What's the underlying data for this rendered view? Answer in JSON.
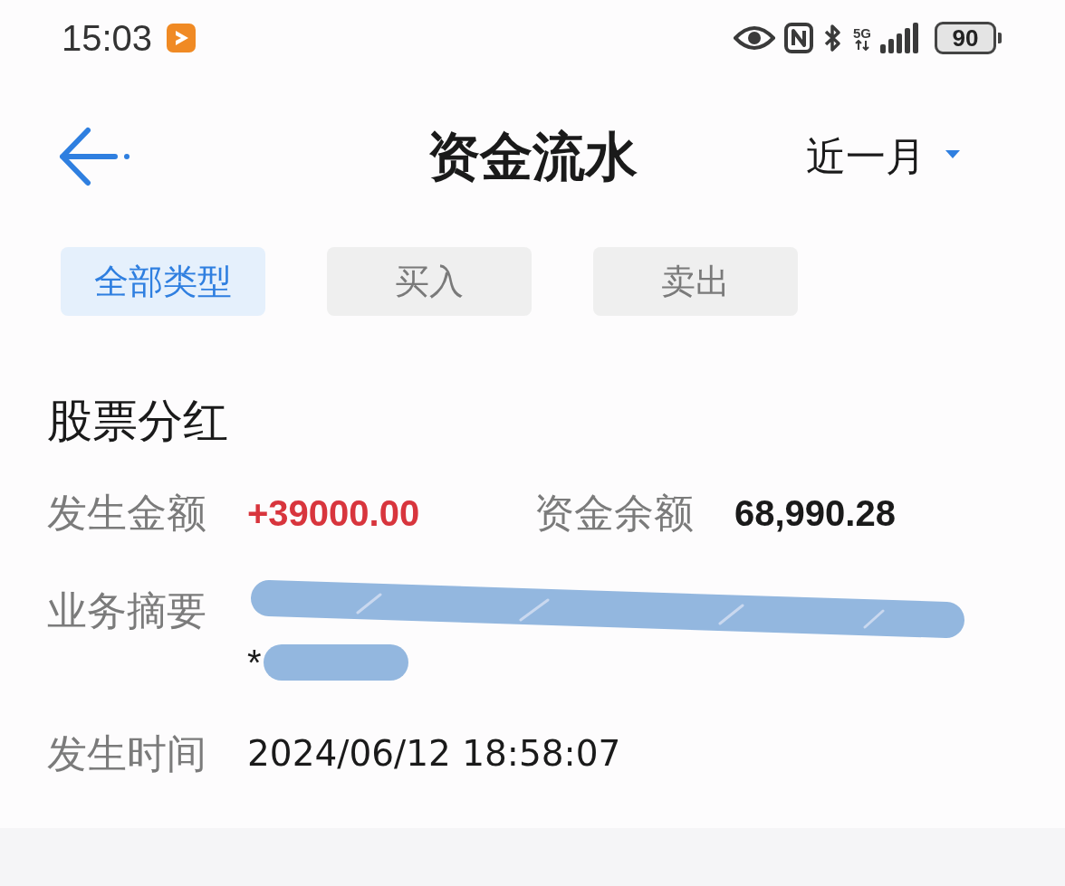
{
  "status_bar": {
    "time": "15:03",
    "network": "5G",
    "battery": "90"
  },
  "header": {
    "title": "资金流水",
    "period": "近一月"
  },
  "tabs": [
    {
      "label": "全部类型",
      "selected": true
    },
    {
      "label": "买入",
      "selected": false
    },
    {
      "label": "卖出",
      "selected": false
    }
  ],
  "record": {
    "title": "股票分红",
    "amount": {
      "label": "发生金额",
      "value": "+39000.00",
      "positive": true
    },
    "balance": {
      "label": "资金余额",
      "value": "68,990.28"
    },
    "summary": {
      "label": "业务摘要",
      "lines": [
        {
          "redacted": true
        },
        {
          "text": "*",
          "redacted": true
        }
      ]
    },
    "time": {
      "label": "发生时间",
      "value": "2024/06/12 18:58:07"
    }
  }
}
